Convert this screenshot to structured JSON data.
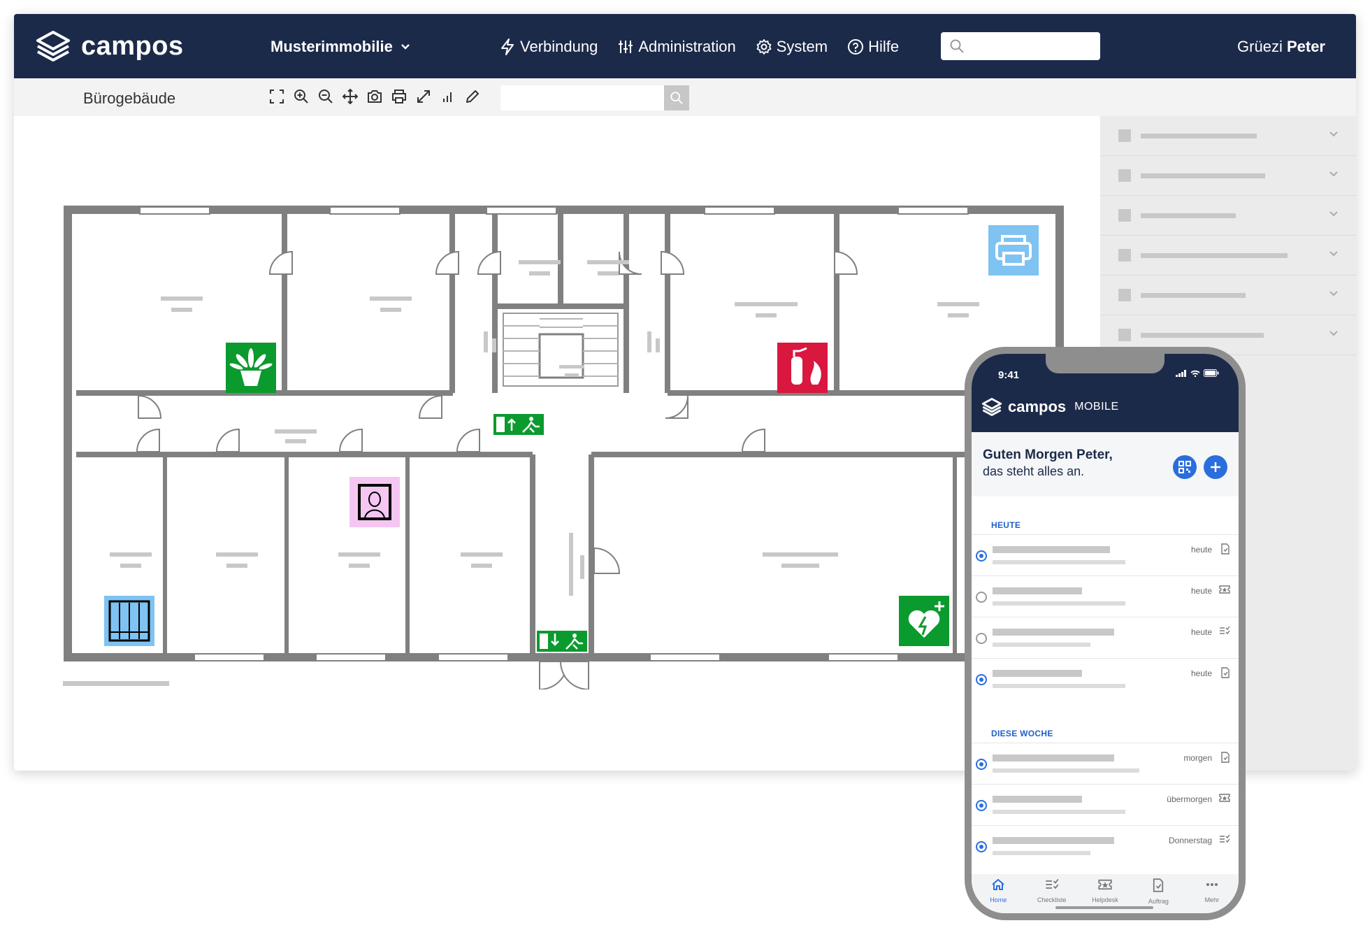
{
  "app": {
    "logo_text": "campos",
    "brand_color": "#1c2a4a",
    "accent_color": "#2a6ede"
  },
  "topbar": {
    "property": "Musterimmobilie",
    "nav": [
      {
        "icon": "bolt-icon",
        "label": "Verbindung"
      },
      {
        "icon": "sliders-icon",
        "label": "Administration"
      },
      {
        "icon": "gear-icon",
        "label": "System"
      },
      {
        "icon": "help-icon",
        "label": "Hilfe"
      }
    ],
    "search_placeholder": "",
    "greeting": "Grüezi",
    "user": "Peter"
  },
  "toolbar": {
    "building": "Bürogebäude",
    "tools": [
      "fullscreen-icon",
      "zoom-in-icon",
      "zoom-out-icon",
      "move-icon",
      "camera-icon",
      "print-icon",
      "expand-icon",
      "chart-icon",
      "pencil-icon"
    ],
    "search_placeholder": ""
  },
  "floorplan": {
    "symbols": [
      "plant-symbol",
      "fire-extinguisher-symbol",
      "printer-symbol",
      "emergency-exit-symbol",
      "artwork-symbol",
      "window-symbol",
      "defibrillator-symbol"
    ],
    "colors": {
      "wall": "#808080",
      "green": "#0b9a2e",
      "red": "#d9173f",
      "blue": "#7ec3f2",
      "pink": "#f6c6f2"
    }
  },
  "phone": {
    "time": "9:41",
    "logo_text": "campos",
    "logo_sub": "MOBILE",
    "greeting_line1": "Guten Morgen Peter,",
    "greeting_line2": "das steht alles an.",
    "section_today": "HEUTE",
    "section_week": "DIESE WOCHE",
    "today_tasks": [
      {
        "due": "heute",
        "icon": "document-icon",
        "state": "active"
      },
      {
        "due": "heute",
        "icon": "ticket-icon",
        "state": "empty"
      },
      {
        "due": "heute",
        "icon": "checklist-icon",
        "state": "empty"
      },
      {
        "due": "heute",
        "icon": "document-icon",
        "state": "active"
      }
    ],
    "week_tasks": [
      {
        "due": "morgen",
        "icon": "document-icon",
        "state": "active"
      },
      {
        "due": "übermorgen",
        "icon": "ticket-icon",
        "state": "active"
      },
      {
        "due": "Donnerstag",
        "icon": "checklist-icon",
        "state": "active"
      }
    ],
    "tabs": [
      {
        "label": "Home",
        "icon": "home-icon",
        "active": true
      },
      {
        "label": "Checkliste",
        "icon": "checklist-icon",
        "active": false
      },
      {
        "label": "Helpdesk",
        "icon": "ticket-icon",
        "active": false
      },
      {
        "label": "Auftrag",
        "icon": "document-icon",
        "active": false
      },
      {
        "label": "Mehr",
        "icon": "more-icon",
        "active": false
      }
    ]
  }
}
